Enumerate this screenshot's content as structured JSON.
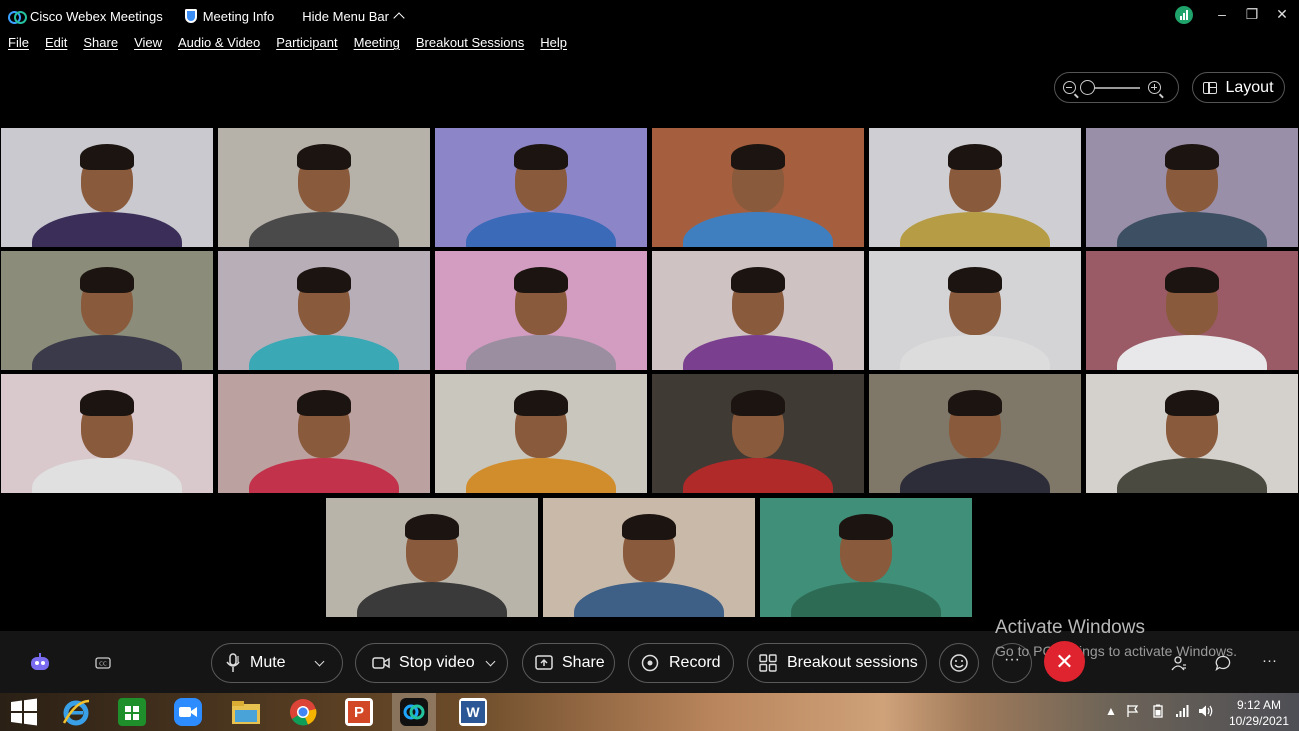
{
  "titlebar": {
    "app_title": "Cisco Webex Meetings",
    "meeting_info": "Meeting Info",
    "hide_menu_bar": "Hide Menu Bar"
  },
  "menu": [
    "File",
    "Edit",
    "Share",
    "View",
    "Audio & Video",
    "Participant",
    "Meeting",
    "Breakout Sessions",
    "Help"
  ],
  "view_controls": {
    "layout_label": "Layout",
    "zoom_level": 0.0
  },
  "participants_count": 21,
  "toolbar": {
    "mute": "Mute",
    "stop_video": "Stop video",
    "share": "Share",
    "record": "Record",
    "breakout": "Breakout sessions",
    "end_color": "#e0242f"
  },
  "watermark": {
    "line1": "Activate Windows",
    "line2": "Go to PC settings to activate Windows."
  },
  "taskbar": {
    "apps": [
      "windows-start-icon",
      "internet-explorer-icon",
      "store-icon",
      "zoom-icon",
      "file-explorer-icon",
      "chrome-icon",
      "powerpoint-icon",
      "webex-icon",
      "word-icon"
    ],
    "time": "9:12 AM",
    "date": "10/29/2021"
  }
}
